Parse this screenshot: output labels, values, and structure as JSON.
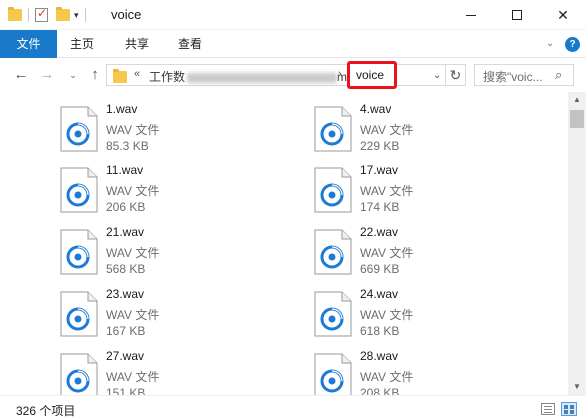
{
  "window": {
    "title": "voice",
    "controls": {
      "minimize_icon": "minimize-icon",
      "maximize_icon": "maximize-icon",
      "close_icon": "close-icon",
      "close_glyph": "✕"
    }
  },
  "quick_access": {
    "icons": [
      "folder-icon",
      "properties-icon",
      "new-folder-icon",
      "customize-caret-icon"
    ],
    "caret": "▾"
  },
  "ribbon": {
    "tabs": [
      {
        "label": "文件",
        "active": true
      },
      {
        "label": "主页",
        "active": false
      },
      {
        "label": "共享",
        "active": false
      },
      {
        "label": "查看",
        "active": false
      }
    ],
    "expand_glyph": "⌄",
    "help_glyph": "?"
  },
  "nav": {
    "back": "←",
    "forward": "→",
    "recent": "⌄",
    "up": "↑"
  },
  "address": {
    "overflow": "«",
    "parent_prefix": "工作数",
    "parent_suffix": "m)",
    "separator": "›",
    "current": "voice",
    "dropdown": "⌄",
    "refresh": "↻"
  },
  "search": {
    "placeholder": "搜索\"voic...",
    "icon": "search-icon",
    "glyph": "⌕"
  },
  "files": [
    {
      "name": "1.wav",
      "type": "WAV 文件",
      "size": "85.3 KB"
    },
    {
      "name": "4.wav",
      "type": "WAV 文件",
      "size": "229 KB"
    },
    {
      "name": "11.wav",
      "type": "WAV 文件",
      "size": "206 KB"
    },
    {
      "name": "17.wav",
      "type": "WAV 文件",
      "size": "174 KB"
    },
    {
      "name": "21.wav",
      "type": "WAV 文件",
      "size": "568 KB"
    },
    {
      "name": "22.wav",
      "type": "WAV 文件",
      "size": "669 KB"
    },
    {
      "name": "23.wav",
      "type": "WAV 文件",
      "size": "167 KB"
    },
    {
      "name": "24.wav",
      "type": "WAV 文件",
      "size": "618 KB"
    },
    {
      "name": "27.wav",
      "type": "WAV 文件",
      "size": "151 KB"
    },
    {
      "name": "28.wav",
      "type": "WAV 文件",
      "size": "208 KB"
    }
  ],
  "scrollbar": {
    "up": "▲",
    "down": "▼"
  },
  "status": {
    "count": "326 个项目"
  },
  "colors": {
    "accent": "#1979ca",
    "highlight_border": "#e8141c",
    "file_icon": "#1d7bd6"
  }
}
